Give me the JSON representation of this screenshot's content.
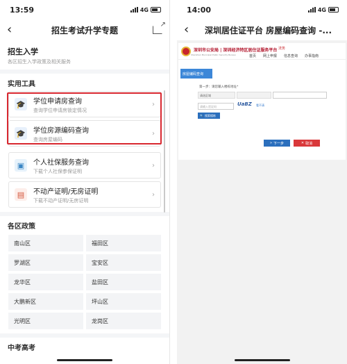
{
  "left": {
    "status_time": "13:59",
    "network": "4G",
    "nav_title": "招生考试升学专题",
    "section": {
      "title": "招生入学",
      "subtitle": "各区招生入学政策及相关服务"
    },
    "tools_title": "实用工具",
    "tools": [
      {
        "title": "学位申请房查询",
        "subtitle": "查询学位申请房锁定情况"
      },
      {
        "title": "学位房源编码查询",
        "subtitle": "查询房屋编码"
      },
      {
        "title": "个人社保服务查询",
        "subtitle": "下载个人社保参保证明"
      },
      {
        "title": "不动产证明/无房证明",
        "subtitle": "下载不动产证明/无房证明"
      }
    ],
    "regions_title": "各区政策",
    "regions": [
      "南山区",
      "福田区",
      "罗湖区",
      "宝安区",
      "龙华区",
      "盐田区",
      "大鹏新区",
      "坪山区",
      "光明区",
      "龙岗区"
    ],
    "next_section": "中考高考",
    "highlight_color": "#d8272f"
  },
  "right": {
    "status_time": "14:00",
    "network": "4G",
    "nav_title": "深圳居住证平台 房屋编码查询 -...",
    "site": {
      "logo_text": "深圳市公安局 | 深圳经济特区居住证服务平台",
      "logo_sub": "Shenzhen Municipal Public Security Bureau",
      "badge": "法务",
      "nav": [
        "首页",
        "网上申报",
        "信息查询",
        "办事指南"
      ],
      "menu": "房屋编码查询",
      "step_text": "第一步：请您输入楼栋地址*",
      "region_select": "请选区域",
      "code_placeholder": "请输入验证码",
      "captcha": "UaBZ",
      "captcha_change": "看不清",
      "search_button": "搜索楼栋",
      "next_button": "下一步",
      "cancel_button": "取消"
    }
  }
}
